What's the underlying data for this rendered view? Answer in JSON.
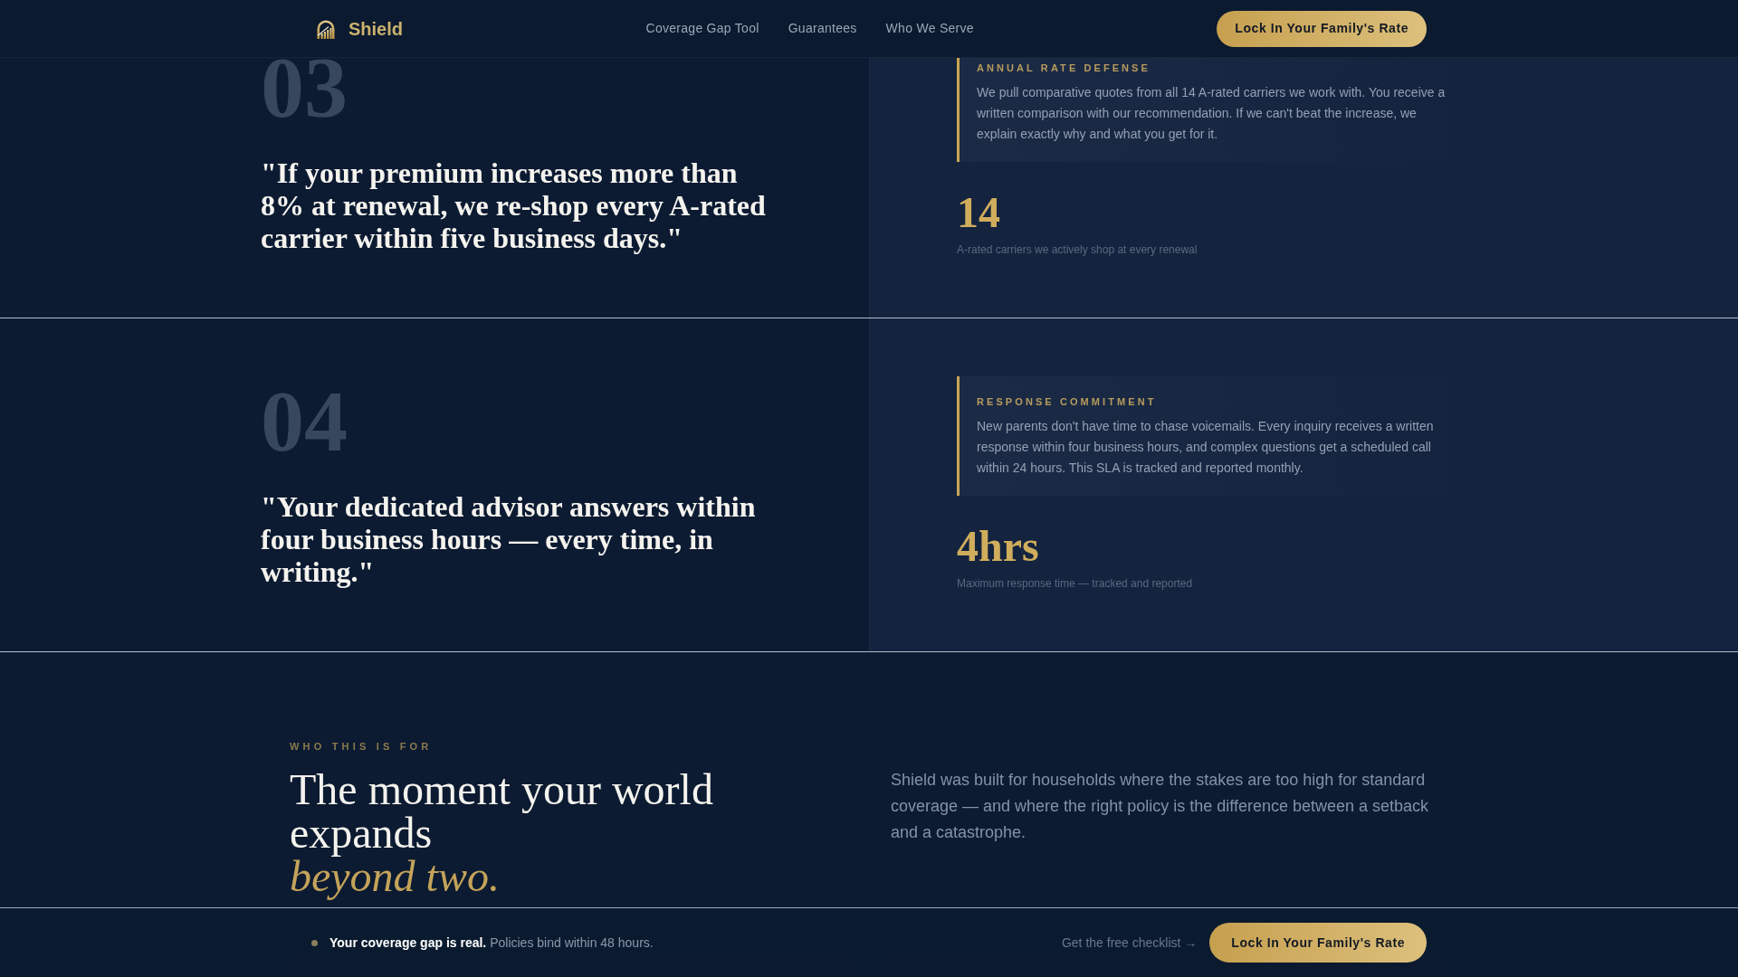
{
  "header": {
    "brand": "Shield",
    "nav": [
      "Coverage Gap Tool",
      "Guarantees",
      "Who We Serve"
    ],
    "cta": "Lock In Your Family's Rate"
  },
  "guarantees": [
    {
      "number": "03",
      "quote": "\"If your premium increases more than 8% at renewal, we re-shop every A-rated carrier within five business days.\"",
      "label": "ANNUAL RATE DEFENSE",
      "description": "We pull comparative quotes from all 14 A-rated carriers we work with. You receive a written comparison with our recommendation. If we can't beat the increase, we explain exactly why and what you get for it.",
      "stat": "14",
      "stat_caption": "A-rated carriers we actively shop at every renewal"
    },
    {
      "number": "04",
      "quote": "\"Your dedicated advisor answers within four business hours — every time, in writing.\"",
      "label": "RESPONSE COMMITMENT",
      "description": "New parents don't have time to chase voicemails. Every inquiry receives a written response within four business hours, and complex questions get a scheduled call within 24 hours. This SLA is tracked and reported monthly.",
      "stat": "4hrs",
      "stat_caption": "Maximum response time — tracked and reported"
    }
  ],
  "audience": {
    "eyebrow": "WHO THIS IS FOR",
    "heading": "The moment your world expands",
    "heading_accent": "beyond two.",
    "description": "Shield was built for households where the stakes are too high for standard coverage — and where the right policy is the difference between a setback and a catastrophe."
  },
  "sticky_bar": {
    "message": "**Your coverage gap is real.** Policies bind within 48 hours.",
    "link": "Get the free checklist →",
    "cta": "Lock In Your Family's Rate"
  }
}
